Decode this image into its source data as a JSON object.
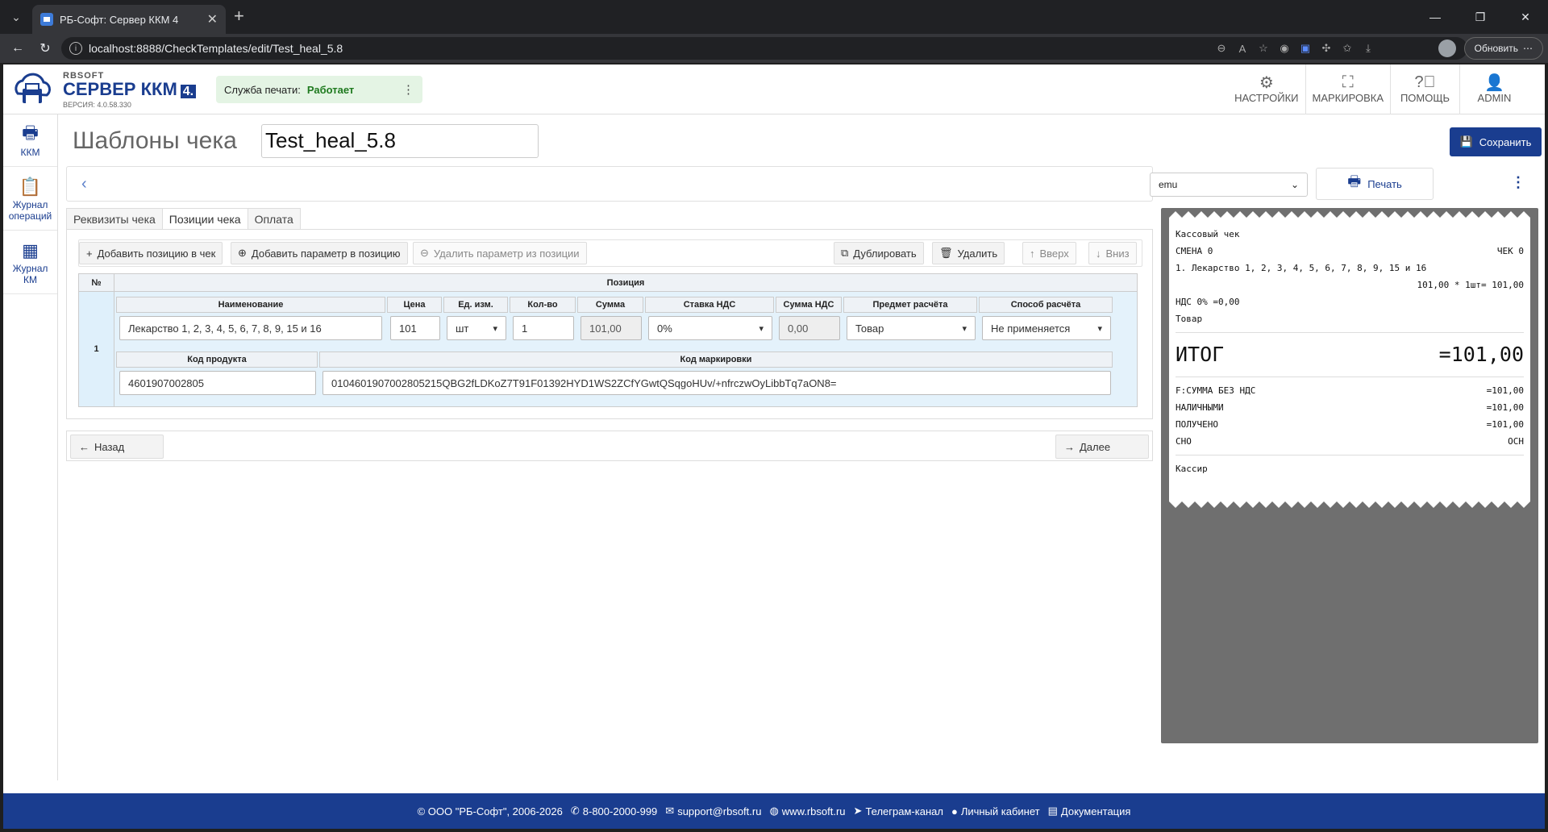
{
  "browser": {
    "tab_title": "РБ-Софт: Сервер ККМ 4",
    "url": "localhost:8888/CheckTemplates/edit/Test_heal_5.8",
    "refresh_label": "Обновить"
  },
  "header": {
    "brand_small": "RBSOFT",
    "brand_main": "СЕРВЕР ККМ",
    "brand_num": "4.",
    "version": "ВЕРСИЯ: 4.0.58.330",
    "service_label": "Служба печати:",
    "service_status": "Работает",
    "nav": [
      {
        "label": "НАСТРОЙКИ",
        "icon": "gear-icon"
      },
      {
        "label": "МАРКИРОВКА",
        "icon": "scan-icon"
      },
      {
        "label": "ПОМОЩЬ",
        "icon": "help-icon"
      },
      {
        "label": "ADMIN",
        "icon": "user-icon"
      }
    ]
  },
  "sidebar": [
    {
      "label": "ККМ",
      "icon": "printer-icon"
    },
    {
      "label": "Журнал операций",
      "icon": "clipboard-icon"
    },
    {
      "label": "Журнал КМ",
      "icon": "qr-icon"
    }
  ],
  "page": {
    "title": "Шаблоны чека",
    "template_name": "Test_heal_5.8",
    "save": "Сохранить",
    "device": "emu",
    "print": "Печать"
  },
  "tabs": [
    "Реквизиты чека",
    "Позиции чека",
    "Оплата"
  ],
  "buttons": {
    "add_position": "Добавить позицию в чек",
    "add_param": "Добавить параметр в позицию",
    "remove_param": "Удалить параметр из позиции",
    "duplicate": "Дублировать",
    "delete": "Удалить",
    "up": "Вверх",
    "down": "Вниз",
    "back": "Назад",
    "next": "Далее"
  },
  "grid": {
    "col_no": "№",
    "col_position": "Позиция",
    "headers": {
      "name": "Наименование",
      "price": "Цена",
      "unit": "Ед. изм.",
      "qty": "Кол-во",
      "sum": "Сумма",
      "vat_rate": "Ставка НДС",
      "vat_sum": "Сумма НДС",
      "subject": "Предмет расчёта",
      "method": "Способ расчёта",
      "product_code": "Код продукта",
      "mark_code": "Код маркировки"
    },
    "row": {
      "no": "1",
      "name": "Лекарство 1, 2, 3, 4, 5, 6, 7, 8, 9, 15 и 16",
      "price": "101",
      "unit": "шт",
      "qty": "1",
      "sum": "101,00",
      "vat_rate": "0%",
      "vat_sum": "0,00",
      "subject": "Товар",
      "method": "Не применяется",
      "product_code": "4601907002805",
      "mark_code": "0104601907002805215QBG2fLDKoZ7T91F01392HYD1WS2ZCfYGwtQSqgoHUv/+nfrczwOyLibbTq7aON8="
    }
  },
  "receipt": {
    "title": "Кассовый чек",
    "shift": "СМЕНА 0",
    "check": "ЧЕК 0",
    "item": "1. Лекарство 1, 2, 3, 4, 5, 6, 7, 8, 9, 15 и 16",
    "calc": "101,00 * 1шт= 101,00",
    "vat": "НДС 0% =0,00",
    "subject": "Товар",
    "total_label": "ИТОГ",
    "total": "=101,00",
    "lines": [
      {
        "l": "F:СУММА БЕЗ НДС",
        "r": "=101,00"
      },
      {
        "l": "НАЛИЧНЫМИ",
        "r": "=101,00"
      },
      {
        "l": "ПОЛУЧЕНО",
        "r": "=101,00"
      },
      {
        "l": "СНО",
        "r": "ОСН"
      }
    ],
    "cashier": "Кассир"
  },
  "footer": {
    "copyright": "© ООО \"РБ-Софт\", 2006-2026",
    "phone": "8-800-2000-999",
    "email": "support@rbsoft.ru",
    "site": "www.rbsoft.ru",
    "telegram": "Телеграм-канал",
    "cabinet": "Личный кабинет",
    "docs": "Документация"
  }
}
